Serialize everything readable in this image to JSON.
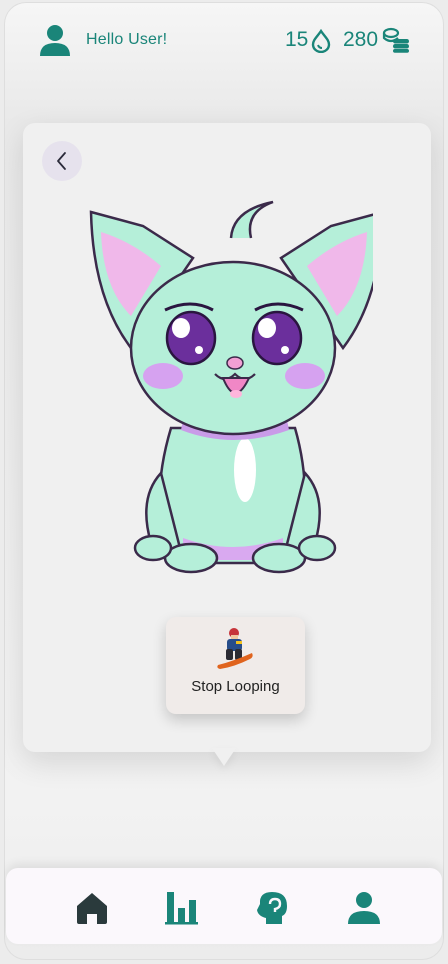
{
  "header": {
    "greeting": "Hello User!",
    "drops_count": "15",
    "coins_count": "280",
    "user_icon": "user-icon",
    "drops_icon": "water-drop-icon",
    "coins_icon": "coins-stack-icon"
  },
  "card": {
    "back_icon": "chevron-left-icon",
    "pet_image": "cartoon-cat-image",
    "loop_chip": {
      "icon": "snowboarder-icon",
      "label": "Stop Looping"
    }
  },
  "bottom_nav": {
    "items": [
      {
        "icon": "home-icon"
      },
      {
        "icon": "bar-chart-icon"
      },
      {
        "icon": "head-icon"
      },
      {
        "icon": "profile-icon"
      }
    ]
  },
  "colors": {
    "accent": "#1a8579",
    "active_nav": "#2a3a3c",
    "pet_body": "#b5efd9",
    "pet_ear": "#f0b8ea",
    "pet_eye": "#6b2f9c"
  }
}
